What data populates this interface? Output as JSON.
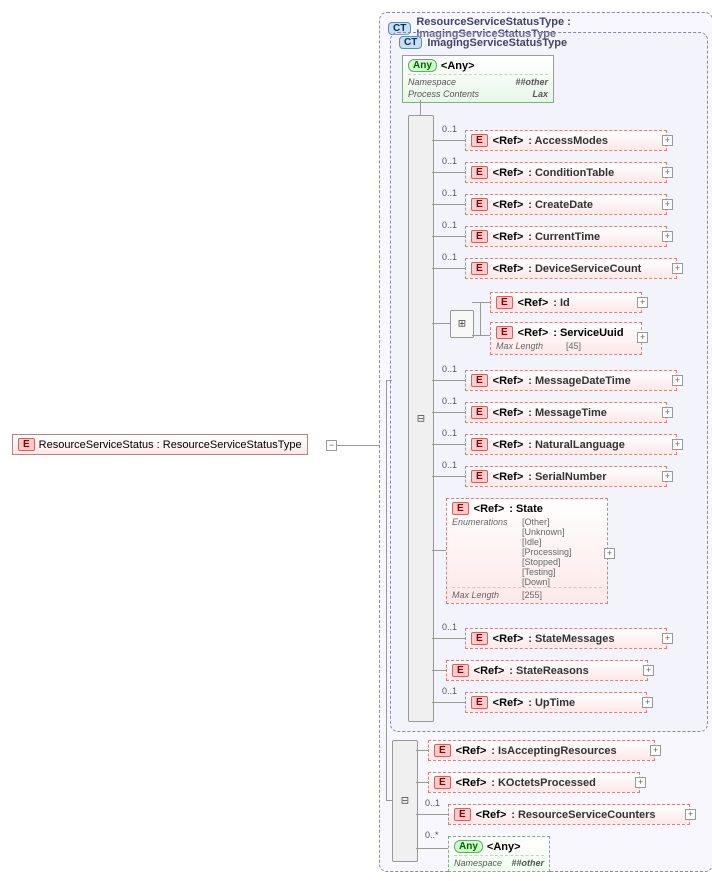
{
  "root": {
    "badge": "E",
    "label": "ResourceServiceStatus : ResourceServiceStatusType"
  },
  "panel": {
    "badge": "CT",
    "title": "ResourceServiceStatusType : ImagingServiceStatusType"
  },
  "inner": {
    "badge": "CT",
    "title": "ImagingServiceStatusType"
  },
  "any_top": {
    "badge": "Any",
    "label": "<Any>",
    "namespace_label": "Namespace",
    "namespace_val": "##other",
    "processcontents_label": "Process Contents",
    "processcontents_val": "Lax"
  },
  "refs_inner": [
    {
      "tag": "<Ref>",
      "type": ": AccessModes",
      "card": "0..1"
    },
    {
      "tag": "<Ref>",
      "type": ": ConditionTable",
      "card": "0..1"
    },
    {
      "tag": "<Ref>",
      "type": ": CreateDate",
      "card": "0..1"
    },
    {
      "tag": "<Ref>",
      "type": ": CurrentTime",
      "card": "0..1"
    },
    {
      "tag": "<Ref>",
      "type": ": DeviceServiceCount",
      "card": "0..1"
    }
  ],
  "choice_refs": [
    {
      "tag": "<Ref>",
      "type": ": Id"
    },
    {
      "tag": "<Ref>",
      "type": ": ServiceUuid",
      "maxlen_label": "Max Length",
      "maxlen_val": "[45]"
    }
  ],
  "refs_mid": [
    {
      "tag": "<Ref>",
      "type": ": MessageDateTime",
      "card": "0..1"
    },
    {
      "tag": "<Ref>",
      "type": ": MessageTime",
      "card": "0..1"
    },
    {
      "tag": "<Ref>",
      "type": ": NaturalLanguage",
      "card": "0..1"
    },
    {
      "tag": "<Ref>",
      "type": ": SerialNumber",
      "card": "0..1"
    }
  ],
  "state": {
    "tag": "<Ref>",
    "type": ": State",
    "enum_label": "Enumerations",
    "enums": [
      "[Other]",
      "[Unknown]",
      "[Idle]",
      "[Processing]",
      "[Stopped]",
      "[Testing]",
      "[Down]"
    ],
    "maxlen_label": "Max Length",
    "maxlen_val": "[255]"
  },
  "refs_bottom_inner": [
    {
      "tag": "<Ref>",
      "type": ": StateMessages",
      "card": "0..1"
    },
    {
      "tag": "<Ref>",
      "type": ": StateReasons"
    },
    {
      "tag": "<Ref>",
      "type": ": UpTime",
      "card": "0..1"
    }
  ],
  "refs_outer": [
    {
      "tag": "<Ref>",
      "type": ": IsAcceptingResources"
    },
    {
      "tag": "<Ref>",
      "type": ": KOctetsProcessed"
    },
    {
      "tag": "<Ref>",
      "type": ": ResourceServiceCounters",
      "card": "0..1"
    }
  ],
  "any_bottom": {
    "badge": "Any",
    "label": "<Any>",
    "namespace_label": "Namespace",
    "namespace_val": "##other",
    "card": "0..*"
  },
  "e_badge": "E"
}
